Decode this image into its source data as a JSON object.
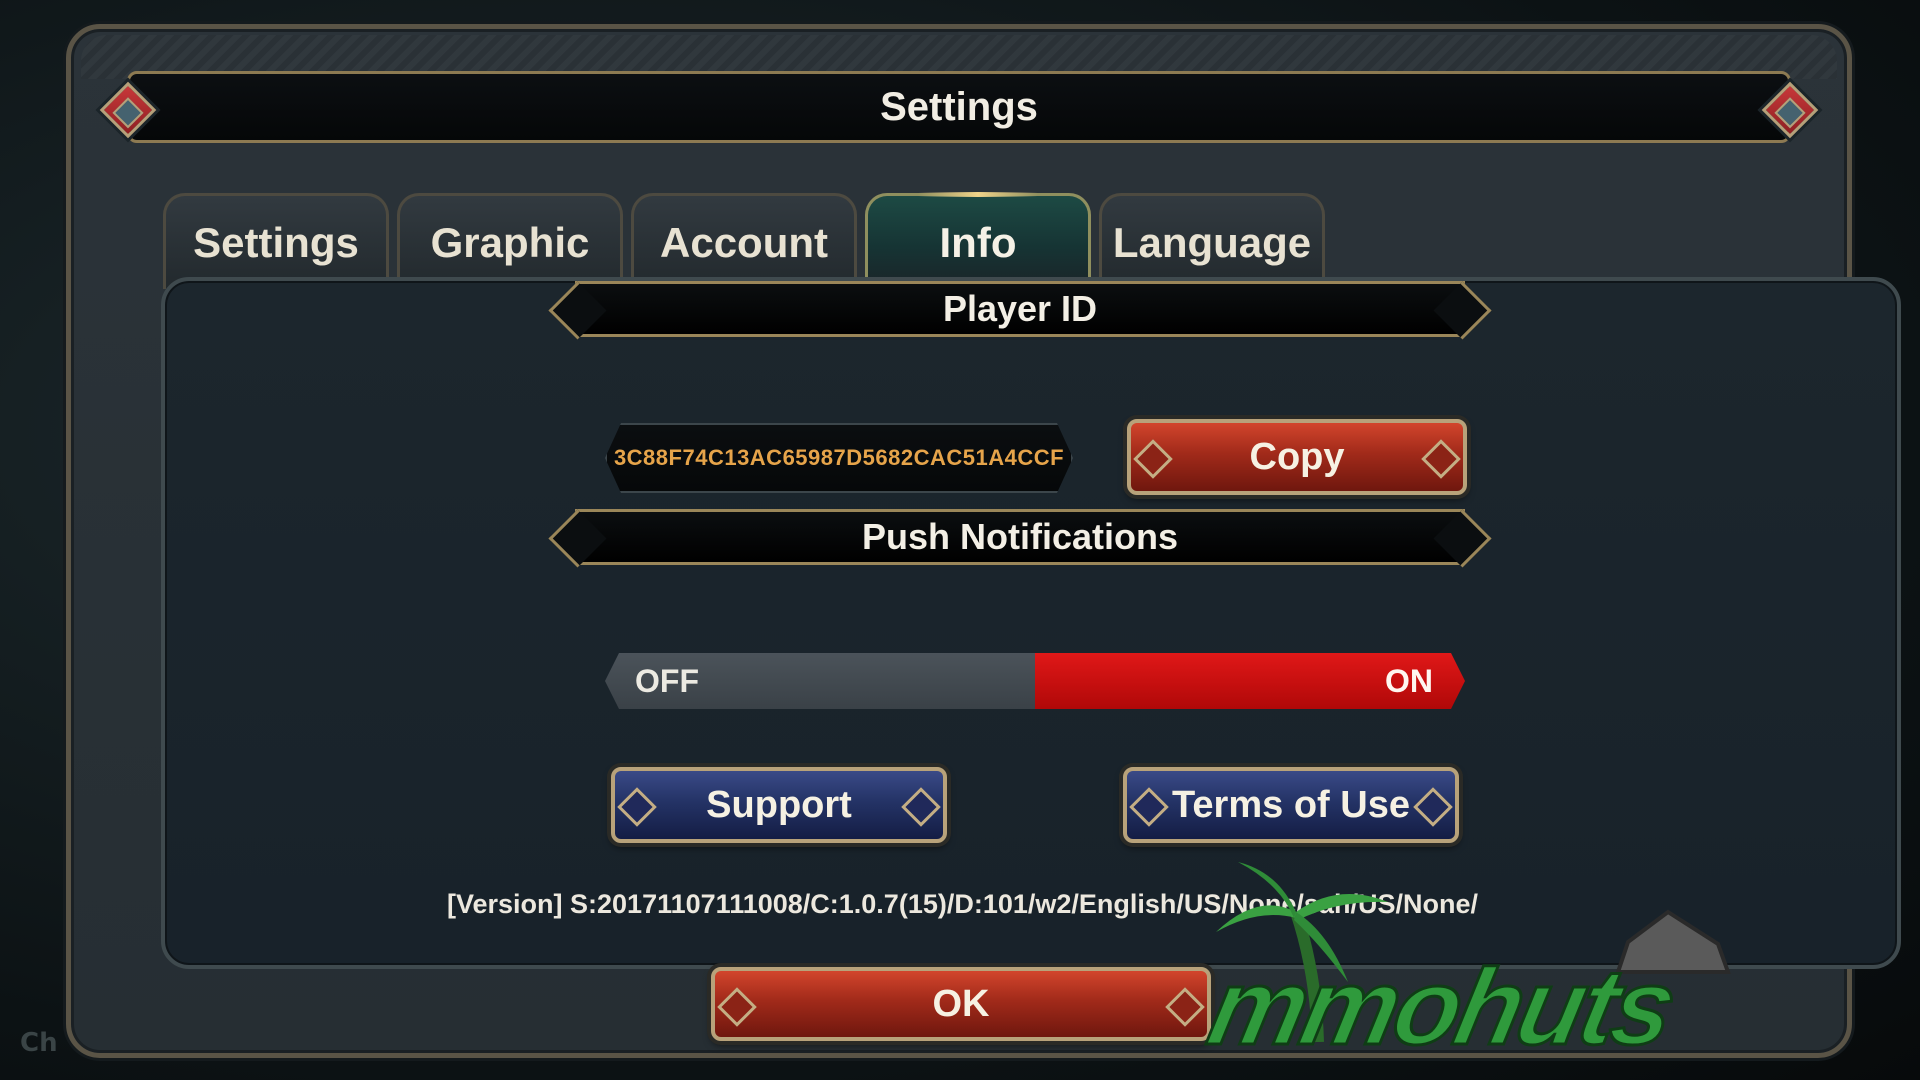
{
  "background": {
    "partial_text": "Ch"
  },
  "dialog": {
    "title": "Settings",
    "tabs": [
      {
        "label": "Settings",
        "active": false
      },
      {
        "label": "Graphic",
        "active": false
      },
      {
        "label": "Account",
        "active": false
      },
      {
        "label": "Info",
        "active": true
      },
      {
        "label": "Language",
        "active": false
      }
    ]
  },
  "info": {
    "player_id_header": "Player ID",
    "player_id_value": "3C88F74C13AC65987D5682CAC51A4CCF",
    "copy_label": "Copy",
    "push_header": "Push Notifications",
    "toggle_off_label": "OFF",
    "toggle_on_label": "ON",
    "push_state": "ON",
    "support_label": "Support",
    "terms_label": "Terms of Use",
    "version": "[Version] S:20171107111008/C:1.0.7(15)/D:101/w2/English/US/None/sah/US/None/"
  },
  "footer": {
    "ok_label": "OK"
  },
  "watermark": {
    "text": "mmohuts"
  },
  "colors": {
    "accent_red": "#b00808",
    "player_id_color": "#e6a44a",
    "active_tab": "#1d4a44",
    "gold_border": "#9a8659"
  }
}
